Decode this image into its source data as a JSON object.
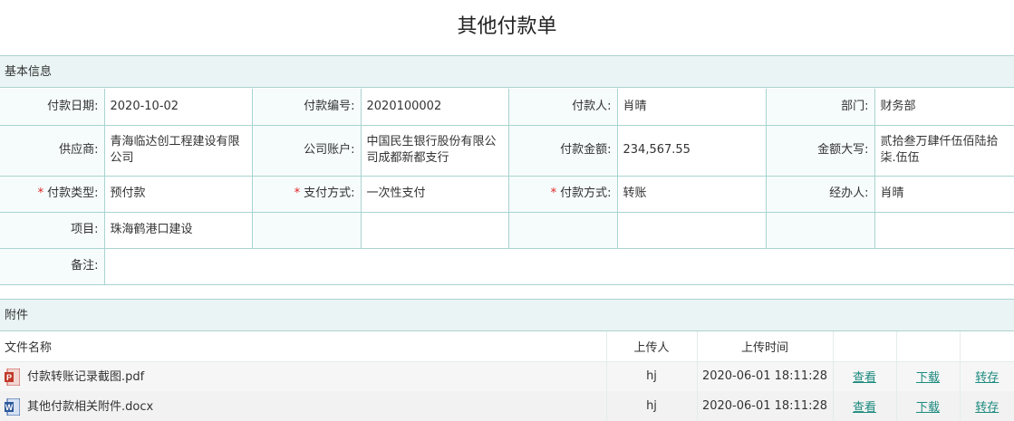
{
  "title": "其他付款单",
  "basic_section": {
    "label": "基本信息"
  },
  "fields": {
    "payment_date": {
      "label": "付款日期:",
      "value": "2020-10-02"
    },
    "payment_no": {
      "label": "付款编号:",
      "value": "2020100002"
    },
    "payer": {
      "label": "付款人:",
      "value": "肖晴"
    },
    "department": {
      "label": "部门:",
      "value": "财务部"
    },
    "supplier": {
      "label": "供应商:",
      "value": "青海临达创工程建设有限公司"
    },
    "company_account": {
      "label": "公司账户:",
      "value": "中国民生银行股份有限公司成都新都支行"
    },
    "amount": {
      "label": "付款金额:",
      "value": "234,567.55"
    },
    "amount_words": {
      "label": "金额大写:",
      "value": "贰拾叁万肆仟伍佰陆拾柒.伍伍"
    },
    "payment_type": {
      "label": "付款类型:",
      "value": "预付款",
      "required_mark": "*"
    },
    "pay_method": {
      "label": "支付方式:",
      "value": "一次性支付",
      "required_mark": "*"
    },
    "payment_way": {
      "label": "付款方式:",
      "value": "转账",
      "required_mark": "*"
    },
    "handler": {
      "label": "经办人:",
      "value": "肖晴"
    },
    "project": {
      "label": "项目:",
      "value": "珠海鹤港口建设"
    },
    "remark": {
      "label": "备注:",
      "value": ""
    }
  },
  "attachments_section": {
    "label": "附件"
  },
  "attachments": {
    "columns": {
      "name": "文件名称",
      "uploader": "上传人",
      "upload_time": "上传时间"
    },
    "files": [
      {
        "name": "付款转账记录截图.pdf",
        "icon": "pdf-icon",
        "uploader": "hj",
        "time": "2020-06-01 18:11:28",
        "view": "查看",
        "download": "下载",
        "save": "转存"
      },
      {
        "name": "其他付款相关附件.docx",
        "icon": "word-icon",
        "uploader": "hj",
        "time": "2020-06-01 18:11:28",
        "view": "查看",
        "download": "下载",
        "save": "转存"
      }
    ]
  },
  "colors": {
    "border": "#a9d4d0",
    "section_bg": "#eaf4f4",
    "link": "#1c8a7e",
    "required": "#e02020"
  }
}
